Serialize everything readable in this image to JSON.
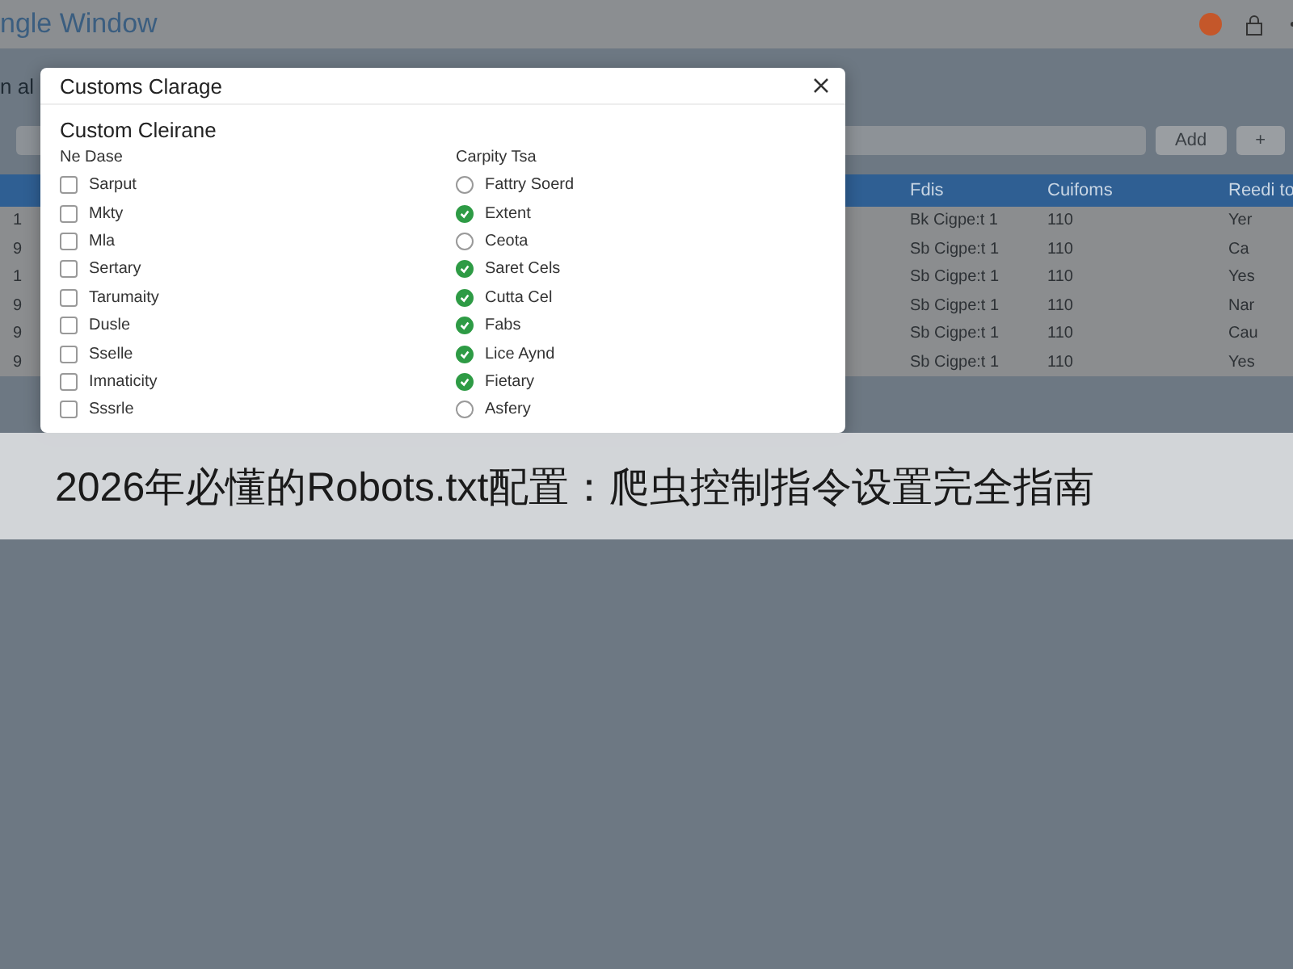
{
  "window": {
    "title": "ngle Window"
  },
  "toolbar": {
    "partial_label": "n al",
    "add_button": "Add",
    "plus_button": "+"
  },
  "table": {
    "columns": [
      "",
      "Fdis",
      "Cuifoms",
      "Reedi to"
    ],
    "rows": [
      [
        "1",
        "Bk Cigpe:t 1",
        "110",
        "Yer"
      ],
      [
        "9",
        "Sb Cigpe:t 1",
        "110",
        "Ca"
      ],
      [
        "1",
        "Sb Cigpe:t 1",
        "110",
        "Yes"
      ],
      [
        "9",
        "Sb Cigpe:t 1",
        "110",
        "Nar"
      ],
      [
        "9",
        "Sb Cigpe:t 1",
        "110",
        "Cau"
      ],
      [
        "9",
        "Sb Cigpe:t 1",
        "110",
        "Yes"
      ]
    ]
  },
  "dialog": {
    "title": "Customs Clarage",
    "subtitle": "Custom Cleirane",
    "left_group": {
      "heading": "Ne Dase",
      "items": [
        {
          "label": "Sarput",
          "checked": false
        },
        {
          "label": "Mkty",
          "checked": false
        },
        {
          "label": "Mla",
          "checked": false
        },
        {
          "label": "Sertary",
          "checked": false
        },
        {
          "label": "Tarumaity",
          "checked": false
        },
        {
          "label": "Dusle",
          "checked": false
        },
        {
          "label": "Sselle",
          "checked": false
        },
        {
          "label": "Imnaticity",
          "checked": false
        },
        {
          "label": "Sssrle",
          "checked": false
        }
      ]
    },
    "right_group": {
      "heading": "Carpity Tsa",
      "items": [
        {
          "label": "Fattry Soerd",
          "checked": false
        },
        {
          "label": "Extent",
          "checked": true
        },
        {
          "label": "Ceota",
          "checked": false
        },
        {
          "label": "Saret Cels",
          "checked": true
        },
        {
          "label": "Cutta Cel",
          "checked": true
        },
        {
          "label": "Fabs",
          "checked": true
        },
        {
          "label": "Lice Aynd",
          "checked": true
        },
        {
          "label": "Fietary",
          "checked": true
        },
        {
          "label": "Asfery",
          "checked": false
        }
      ]
    }
  },
  "caption_banner": "2026年必懂的Robots.txt配置：爬虫控制指令设置完全指南"
}
